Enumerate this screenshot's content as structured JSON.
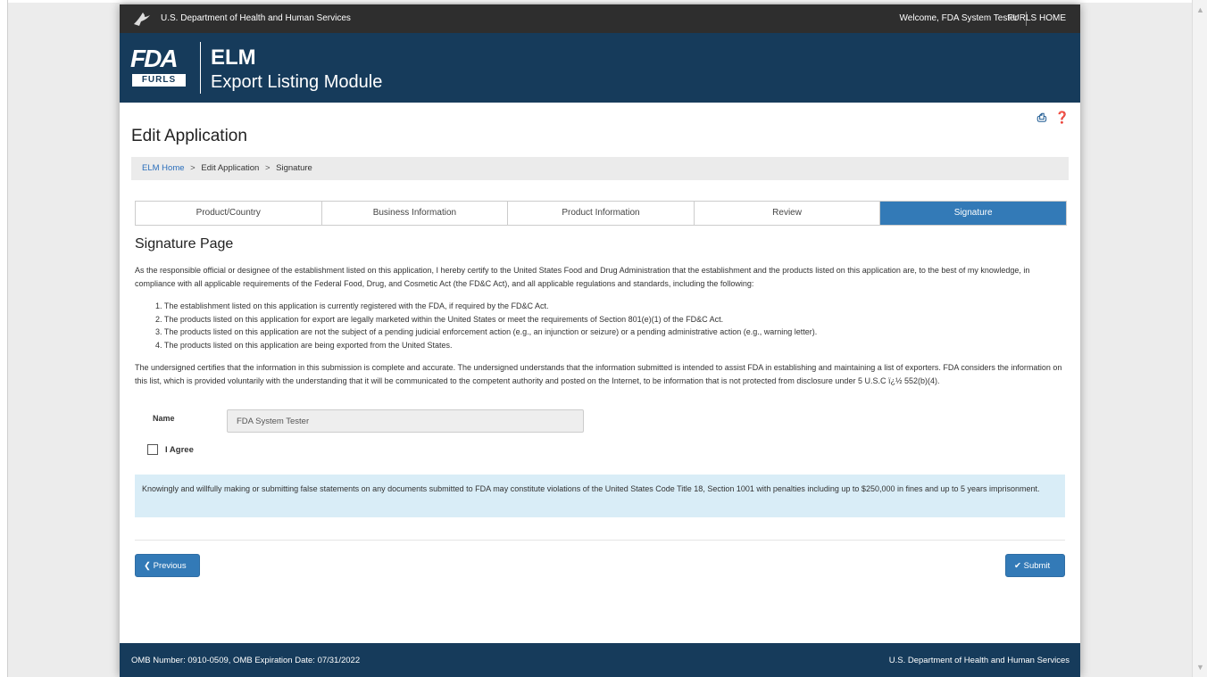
{
  "header": {
    "agency": "U.S. Department of Health and Human Services",
    "welcome": "Welcome, FDA System Tester",
    "home_link": "FURLS HOME"
  },
  "banner": {
    "logo_text": "FDA",
    "logo_sub": "FURLS",
    "app_short": "ELM",
    "app_full": "Export Listing Module"
  },
  "tools": {
    "print_icon": "print-icon",
    "help_icon": "help-icon"
  },
  "page_title": "Edit Application",
  "breadcrumb": {
    "home": "ELM Home",
    "step": "Edit Application",
    "current": "Signature",
    "separator": ">"
  },
  "tabs": [
    {
      "label": "Product/Country"
    },
    {
      "label": "Business Information"
    },
    {
      "label": "Product Information"
    },
    {
      "label": "Review"
    },
    {
      "label": "Signature"
    }
  ],
  "signature": {
    "heading": "Signature Page",
    "intro": "As the responsible official or designee of the establishment listed on this application, I hereby certify to the United States Food and Drug Administration that the establishment and the products listed on this application are, to the best of my knowledge, in compliance with all applicable requirements of the Federal Food, Drug, and Cosmetic Act (the FD&C Act), and all applicable regulations and standards, including the following:",
    "items": [
      "1. The establishment listed on this application is currently registered with the FDA, if required by the FD&C Act.",
      "2. The products listed on this application for export are legally marketed within the United States or meet the requirements of Section 801(e)(1) of the FD&C Act.",
      "3. The products listed on this application are not the subject of a pending judicial enforcement action (e.g., an injunction or seizure) or a pending administrative action (e.g., warning letter).",
      "4. The products listed on this application are being exported from the United States."
    ],
    "certify": "The undersigned certifies that the information in this submission is complete and accurate. The undersigned understands that the information submitted is intended to assist FDA in establishing and maintaining a list of exporters. FDA considers the information on this list, which is provided voluntarily with the understanding that it will be communicated to the competent authority and posted on the Internet, to be information that is not protected from disclosure under 5 U.S.C ï¿½ 552(b)(4).",
    "name_label": "Name",
    "name_value": "FDA System Tester",
    "agree_label": "I Agree",
    "warning": "Knowingly and willfully making or submitting false statements on any documents submitted to FDA may constitute violations of the United States Code Title 18, Section 1001 with penalties including up to $250,000 in fines and up to 5 years imprisonment."
  },
  "buttons": {
    "previous": "Previous",
    "submit": "Submit"
  },
  "footer": {
    "omb": "OMB Number: 0910-0509, OMB Expiration Date: 07/31/2022",
    "dept": "U.S. Department of Health and Human Services"
  },
  "colors": {
    "navy": "#163b5b",
    "accent": "#337ab7",
    "alert_bg": "#d9edf7"
  }
}
